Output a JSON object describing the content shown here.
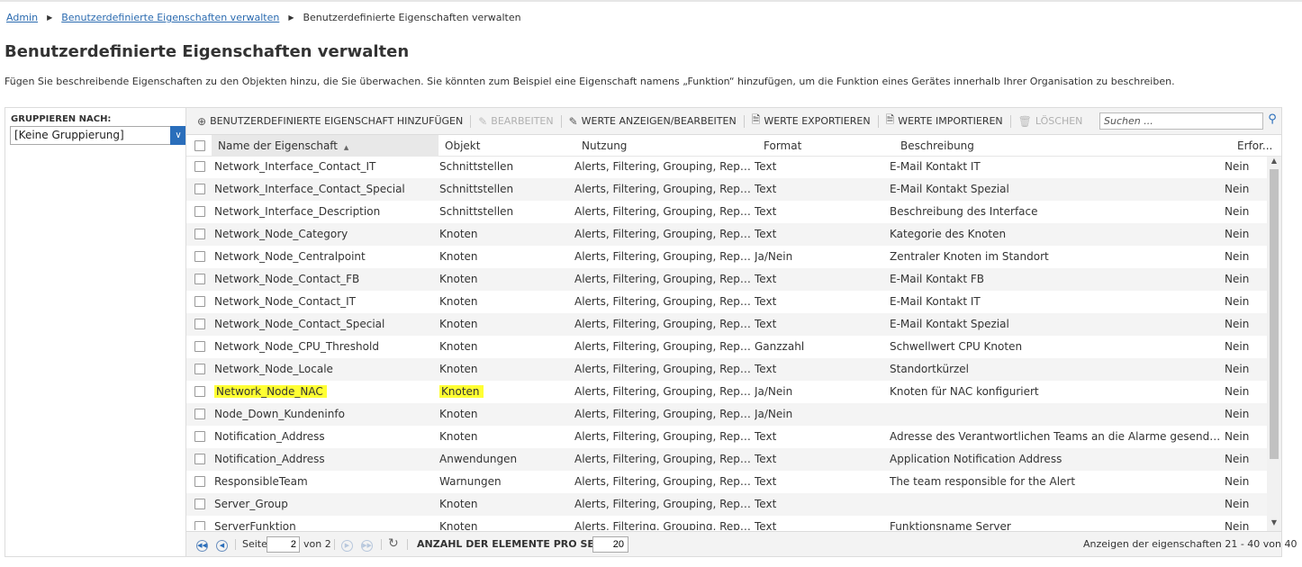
{
  "breadcrumb": {
    "items": [
      "Admin",
      "Benutzerdefinierte Eigenschaften verwalten"
    ],
    "current": "Benutzerdefinierte Eigenschaften verwalten"
  },
  "page": {
    "title": "Benutzerdefinierte Eigenschaften verwalten",
    "description": "Fügen Sie beschreibende Eigenschaften zu den Objekten hinzu, die Sie überwachen. Sie könnten zum Beispiel eine Eigenschaft namens „Funktion“ hinzufügen, um die Funktion eines Gerätes innerhalb Ihrer Organisation zu beschreiben."
  },
  "grouping": {
    "label": "GRUPPIEREN NACH:",
    "selected": "[Keine Gruppierung]"
  },
  "toolbar": {
    "add": "BENUTZERDEFINIERTE EIGENSCHAFT HINZUFÜGEN",
    "edit": "BEARBEITEN",
    "view_edit_values": "WERTE ANZEIGEN/BEARBEITEN",
    "export_values": "WERTE EXPORTIEREN",
    "import_values": "WERTE IMPORTIEREN",
    "delete": "LÖSCHEN",
    "search_placeholder": "Suchen ..."
  },
  "table": {
    "columns": {
      "name": "Name der Eigenschaft",
      "object": "Objekt",
      "usage": "Nutzung",
      "format": "Format",
      "description": "Beschreibung",
      "required": "Erfor..."
    },
    "rows": [
      {
        "name": "Network_Interface_Contact_IT",
        "object": "Schnittstellen",
        "usage": "Alerts, Filtering, Grouping, Repor...",
        "format": "Text",
        "description": "E-Mail Kontakt IT",
        "required": "Nein"
      },
      {
        "name": "Network_Interface_Contact_Special",
        "object": "Schnittstellen",
        "usage": "Alerts, Filtering, Grouping, Repor...",
        "format": "Text",
        "description": "E-Mail Kontakt Spezial",
        "required": "Nein"
      },
      {
        "name": "Network_Interface_Description",
        "object": "Schnittstellen",
        "usage": "Alerts, Filtering, Grouping, Repor...",
        "format": "Text",
        "description": "Beschreibung des Interface",
        "required": "Nein"
      },
      {
        "name": "Network_Node_Category",
        "object": "Knoten",
        "usage": "Alerts, Filtering, Grouping, Repor...",
        "format": "Text",
        "description": "Kategorie des Knoten",
        "required": "Nein"
      },
      {
        "name": "Network_Node_Centralpoint",
        "object": "Knoten",
        "usage": "Alerts, Filtering, Grouping, Repor...",
        "format": "Ja/Nein",
        "description": "Zentraler Knoten im Standort",
        "required": "Nein"
      },
      {
        "name": "Network_Node_Contact_FB",
        "object": "Knoten",
        "usage": "Alerts, Filtering, Grouping, Repor...",
        "format": "Text",
        "description": "E-Mail Kontakt FB",
        "required": "Nein"
      },
      {
        "name": "Network_Node_Contact_IT",
        "object": "Knoten",
        "usage": "Alerts, Filtering, Grouping, Repor...",
        "format": "Text",
        "description": "E-Mail Kontakt IT",
        "required": "Nein"
      },
      {
        "name": "Network_Node_Contact_Special",
        "object": "Knoten",
        "usage": "Alerts, Filtering, Grouping, Repor...",
        "format": "Text",
        "description": "E-Mail Kontakt Spezial",
        "required": "Nein"
      },
      {
        "name": "Network_Node_CPU_Threshold",
        "object": "Knoten",
        "usage": "Alerts, Filtering, Grouping, Repor...",
        "format": "Ganzzahl",
        "description": "Schwellwert CPU Knoten",
        "required": "Nein"
      },
      {
        "name": "Network_Node_Locale",
        "object": "Knoten",
        "usage": "Alerts, Filtering, Grouping, Repor...",
        "format": "Text",
        "description": "Standortkürzel",
        "required": "Nein"
      },
      {
        "name": "Network_Node_NAC",
        "object": "Knoten",
        "usage": "Alerts, Filtering, Grouping, Repor...",
        "format": "Ja/Nein",
        "description": "Knoten für NAC konfiguriert",
        "required": "Nein",
        "highlight": true
      },
      {
        "name": "Node_Down_Kundeninfo",
        "object": "Knoten",
        "usage": "Alerts, Filtering, Grouping, Repor...",
        "format": "Ja/Nein",
        "description": "",
        "required": "Nein"
      },
      {
        "name": "Notification_Address",
        "object": "Knoten",
        "usage": "Alerts, Filtering, Grouping, Repor...",
        "format": "Text",
        "description": "Adresse des Verantwortlichen Teams an die Alarme gesendet w...",
        "required": "Nein"
      },
      {
        "name": "Notification_Address",
        "object": "Anwendungen",
        "usage": "Alerts, Filtering, Grouping, Repor...",
        "format": "Text",
        "description": "Application Notification Address",
        "required": "Nein"
      },
      {
        "name": "ResponsibleTeam",
        "object": "Warnungen",
        "usage": "Alerts, Filtering, Grouping, Repor...",
        "format": "Text",
        "description": "The team responsible for the Alert",
        "required": "Nein"
      },
      {
        "name": "Server_Group",
        "object": "Knoten",
        "usage": "Alerts, Filtering, Grouping, Repor...",
        "format": "Text",
        "description": "",
        "required": "Nein"
      },
      {
        "name": "ServerFunktion",
        "object": "Knoten",
        "usage": "Alerts, Filtering, Grouping, Repor...",
        "format": "Text",
        "description": "Funktionsname Server",
        "required": "Nein"
      }
    ]
  },
  "pager": {
    "page_label": "Seite",
    "page_value": "2",
    "of_label": "von 2",
    "per_page_label": "ANZAHL DER ELEMENTE PRO SEITE:",
    "per_page_value": "20",
    "summary": "Anzeigen der eigenschaften 21 - 40 von 40"
  },
  "colors": {
    "accent": "#2a6ebb",
    "highlight": "#ffff33",
    "row_alt": "#f4f4f4"
  }
}
